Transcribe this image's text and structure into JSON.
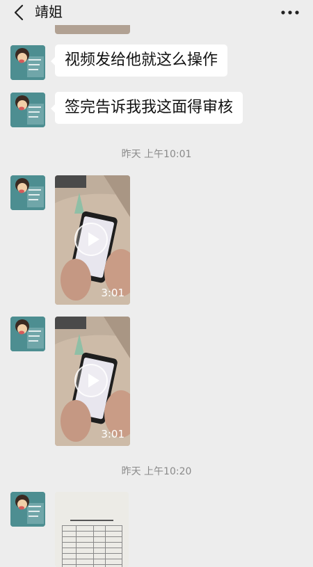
{
  "header": {
    "title": "靖姐",
    "back_icon": "chevron-left-icon",
    "more_icon": "more-horizontal-icon"
  },
  "messages": [
    {
      "type": "text",
      "text": "视频发给他就这么操作"
    },
    {
      "type": "text",
      "text": "签完告诉我我这面得审核"
    }
  ],
  "timestamps": [
    "昨天 上午10:01",
    "昨天 上午10:20"
  ],
  "videos": [
    {
      "duration": "3:01"
    },
    {
      "duration": "3:01"
    }
  ],
  "colors": {
    "background": "#ededed",
    "bubble": "#ffffff",
    "avatar": "#4d8e91"
  }
}
